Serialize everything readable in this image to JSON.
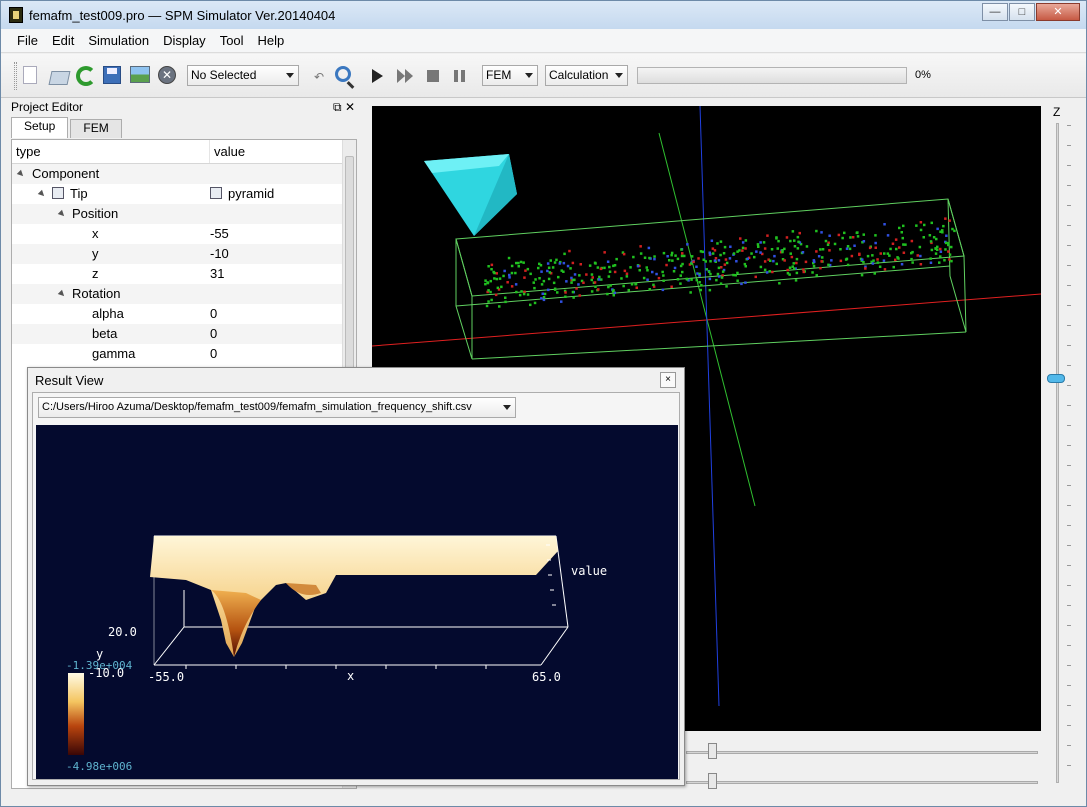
{
  "window": {
    "title": "femafm_test009.pro — SPM Simulator Ver.20140404",
    "minimize": "—",
    "maximize": "□",
    "close": "✕"
  },
  "menu": [
    "File",
    "Edit",
    "Simulation",
    "Display",
    "Tool",
    "Help"
  ],
  "toolbar": {
    "selection_combo": "No Selected",
    "mode_combo": "FEM",
    "calc_combo": "Calculation",
    "progress_percent": 0,
    "progress_label": "0%",
    "undo_glyph": "↶",
    "close_glyph": "✕"
  },
  "project_editor": {
    "title": "Project Editor",
    "float_glyph": "⧉",
    "close_glyph": "✕",
    "tabs": [
      "Setup",
      "FEM"
    ],
    "columns": [
      "type",
      "value"
    ],
    "rows": [
      {
        "label": "Component",
        "value": ""
      },
      {
        "label": "Tip",
        "value": "pyramid"
      },
      {
        "label": "Position",
        "value": ""
      },
      {
        "label": "x",
        "value": "-55"
      },
      {
        "label": "y",
        "value": "-10"
      },
      {
        "label": "z",
        "value": "31"
      },
      {
        "label": "Rotation",
        "value": ""
      },
      {
        "label": "alpha",
        "value": "0"
      },
      {
        "label": "beta",
        "value": "0"
      },
      {
        "label": "gamma",
        "value": "0"
      }
    ]
  },
  "viewport": {
    "axis_label": "Z"
  },
  "result_view": {
    "title": "Result View",
    "close_glyph": "×",
    "file": "C:/Users/Hiroo Azuma/Desktop/femafm_test009/femafm_simulation_frequency_shift.csv",
    "plot": {
      "value_label": "value",
      "x_label": "x",
      "y_label": "y",
      "x_min": "-55.0",
      "x_max": "65.0",
      "y_top": "20.0",
      "y_bottom": "-10.0",
      "colorbar_max": "-1.39e+004",
      "colorbar_min": "-4.98e+006"
    }
  },
  "colors": {
    "viewport_bg": "#000000",
    "plot_bg": "#040a2e",
    "tip": "#2fd6e0",
    "x_axis": "#e02020",
    "y_axis": "#30c030",
    "z_axis": "#2040e0",
    "box": "#60d060"
  }
}
